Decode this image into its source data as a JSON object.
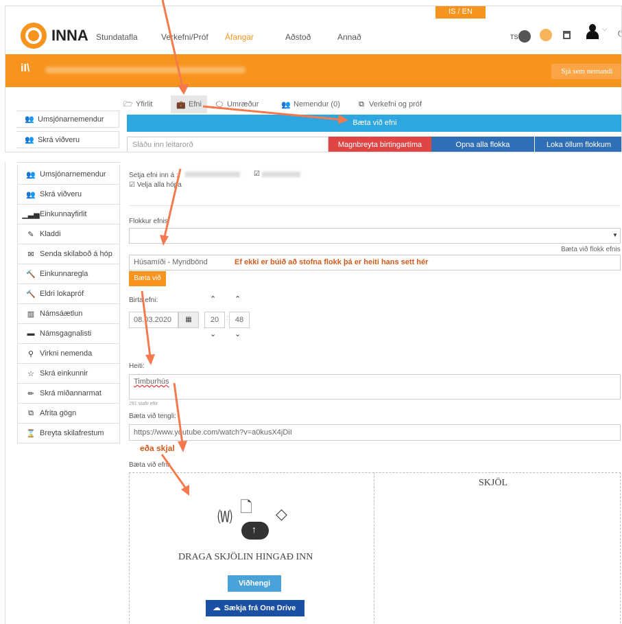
{
  "header": {
    "lang": "IS / EN",
    "brand": "INNA",
    "nav": [
      "Stundatafla",
      "Verkefni/Próf",
      "Áfangar",
      "Aðstoð",
      "Annað"
    ],
    "ts_label": "TS"
  },
  "course_bar": {
    "button": "Sjá sem nemandi"
  },
  "tabs": [
    "Yfirlit",
    "Efni",
    "Umræður",
    "Nemendur (0)",
    "Verkefni og próf"
  ],
  "top_side": [
    "Umsjónarnemendur",
    "Skrá viðveru"
  ],
  "add_content_bar": "Bæta við efni",
  "search_placeholder": "Sláðu inn leitarorð",
  "buttons": {
    "bulk": "Magnbreyta birtingartíma",
    "open": "Opna alla flokka",
    "close": "Loka öllum flokkum"
  },
  "sidebar": [
    "Umsjónarnemendur",
    "Skrá viðveru",
    "Einkunnayfirlit",
    "Kladdi",
    "Senda skilaboð á hóp",
    "Einkunnaregla",
    "Eldri lokapróf",
    "Námsáætlun",
    "Námsgagnalisti",
    "Virkni nemenda",
    "Skrá einkunnir",
    "Skrá miðannarmat",
    "Afrita gögn",
    "Breyta skilafrestum"
  ],
  "form": {
    "setja_label": "Setja efni inn á :",
    "select_all": "Velja alla hópa",
    "flokkur_label": "Flokkur efnis",
    "add_category_link": "Bæta við flokk efnis",
    "category_input": "Húsamíði - Myndbönd",
    "annotation": "Ef ekki er búið að stofna flokk þá er heiti hans sett hér",
    "add_button": "Bæta við",
    "publish_label": "Birta efni:",
    "date": "08.03.2020",
    "hour": "20",
    "minute": "48",
    "title_label": "Heiti:",
    "title_value": "Timburhús",
    "char_count": "291 stafir eftir",
    "link_label": "Bæta við tengli:",
    "link_value": "https://www.youtube.com/watch?v=a0kusX4jDiI",
    "or_file": "eða skjal",
    "file_label": "Bæta við efni:",
    "drop_text": "DRAGA SKJÖLIN HINGAÐ INN",
    "attach_button": "Viðhengi",
    "onedrive_button": "Sækja frá One Drive",
    "files_heading": "SKJÖL"
  },
  "colors": {
    "orange": "#f7941d",
    "blue": "#2ea6e0",
    "red": "#e04545",
    "darkblue": "#2f6fb5",
    "annotation": "#d05a1a"
  }
}
